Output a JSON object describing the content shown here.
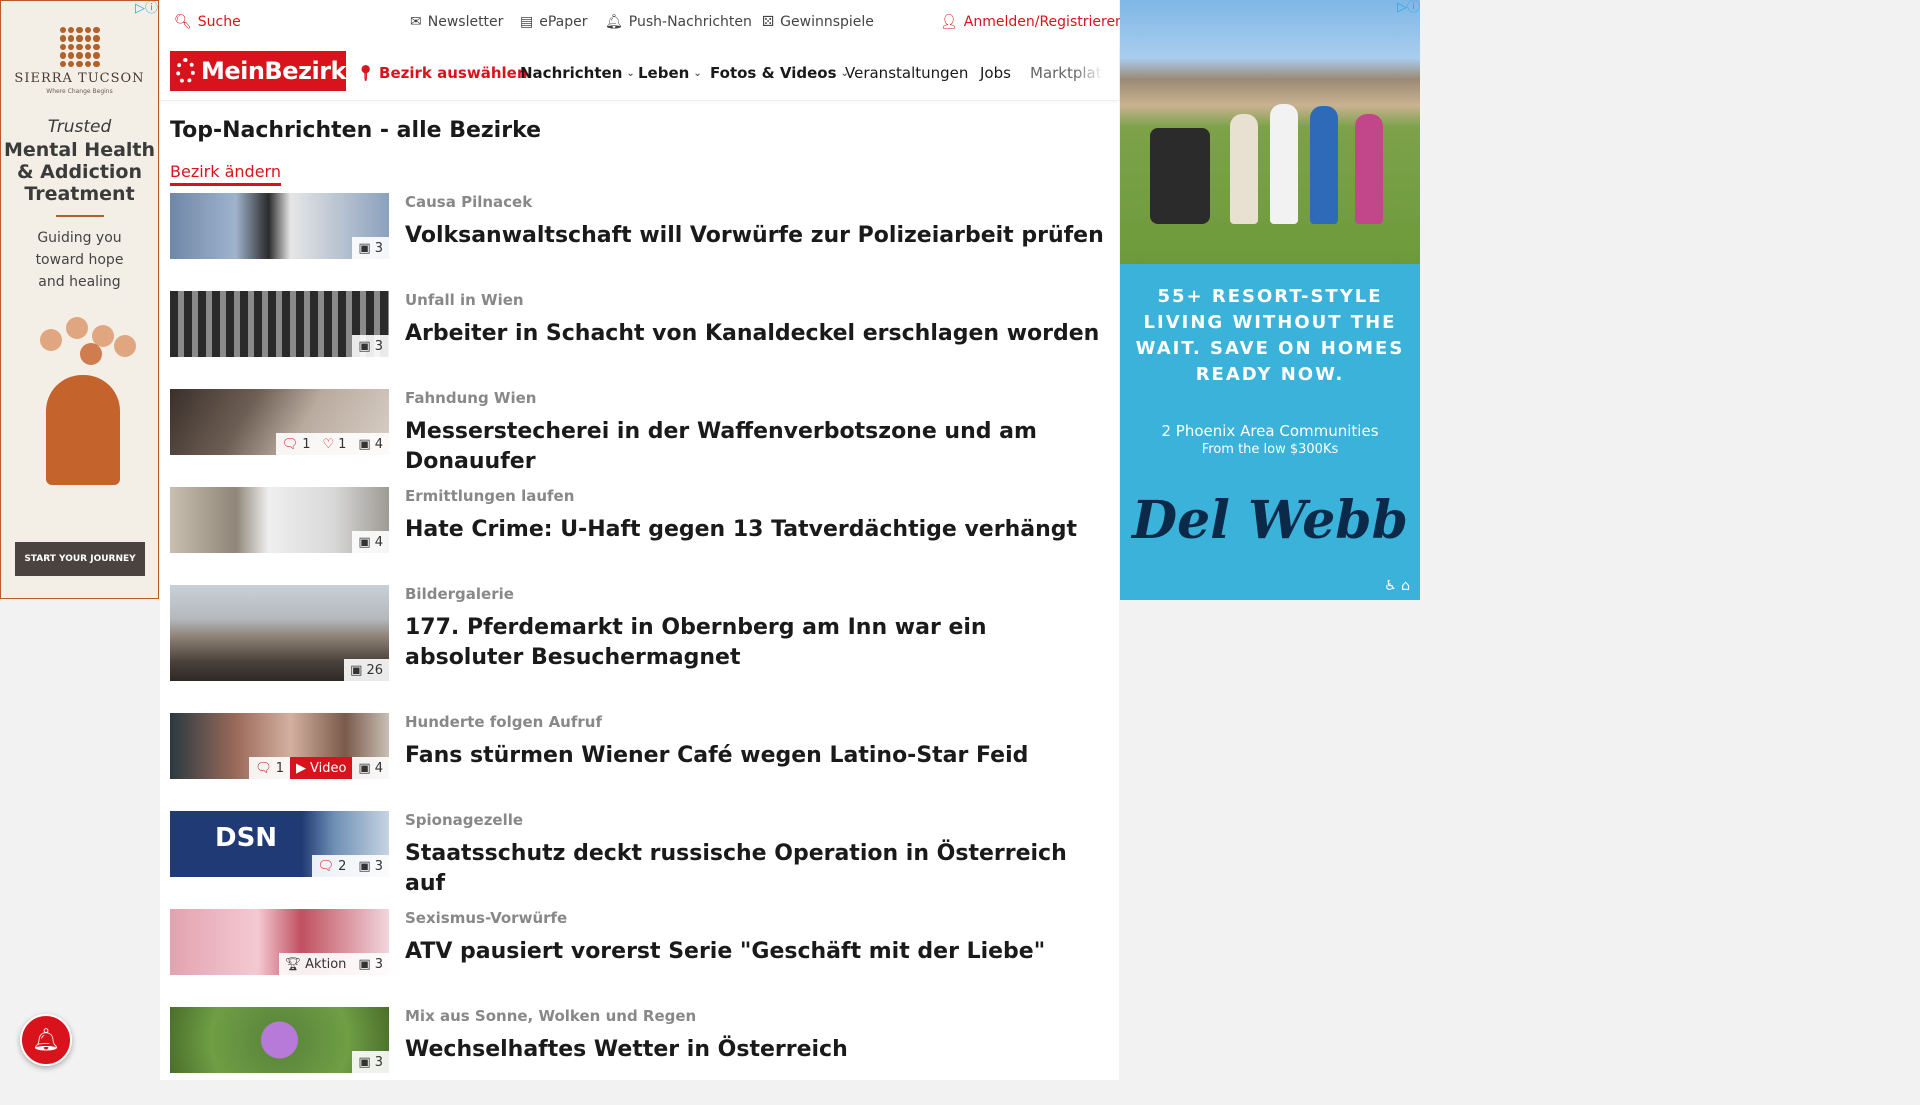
{
  "ad_left": {
    "brand": "SIERRA TUCSON",
    "brand_tag": "Where Change Begins",
    "trusted": "Trusted",
    "headline": "Mental Health & Addiction Treatment",
    "subline": "Guiding you toward hope and healing",
    "cta": "START YOUR JOURNEY",
    "colors": {
      "accent": "#b0612d",
      "bg": "#f3efe7"
    }
  },
  "topbar": {
    "search": "Suche",
    "newsletter": "Newsletter",
    "epaper": "ePaper",
    "push": "Push-Nachrichten",
    "games": "Gewinnspiele",
    "login": "Anmelden/Registrieren"
  },
  "nav": {
    "logo": "MeinBezirk",
    "choose_district": "Bezirk auswählen",
    "items": [
      "Nachrichten",
      "Leben",
      "Fotos & Videos",
      "Veranstaltungen",
      "Jobs",
      "Marktplatz"
    ]
  },
  "section": {
    "title": "Top-Nachrichten - alle Bezirke",
    "change": "Bezirk ändern"
  },
  "articles": [
    {
      "kicker": "Causa Pilnacek",
      "title": "Volksanwaltschaft will Vorwürfe zur Polizeiarbeit prüfen",
      "comments": "",
      "likes": "",
      "photos": "3"
    },
    {
      "kicker": "Unfall in Wien",
      "title": "Arbeiter in Schacht von Kanaldeckel erschlagen worden",
      "comments": "",
      "likes": "",
      "photos": "3"
    },
    {
      "kicker": "Fahndung Wien",
      "title": "Messerstecherei in der Waffenverbotszone und am Donauufer",
      "comments": "1",
      "likes": "1",
      "photos": "4"
    },
    {
      "kicker": "Ermittlungen laufen",
      "title": "Hate Crime: U-Haft gegen 13 Tatverdächtige verhängt",
      "comments": "",
      "likes": "",
      "photos": "4"
    },
    {
      "kicker": "Bildergalerie",
      "title": "177. Pferdemarkt in Obernberg am Inn war ein absoluter Besuchermagnet",
      "comments": "",
      "likes": "",
      "photos": "26"
    },
    {
      "kicker": "Hunderte folgen Aufruf",
      "title": "Fans stürmen Wiener Café wegen Latino-Star Feid",
      "comments": "1",
      "video": "Video",
      "photos": "4"
    },
    {
      "kicker": "Spionagezelle",
      "title": "Staatsschutz deckt russische Operation in Österreich auf",
      "comments": "2",
      "photos": "3",
      "thumb_text": "DSN"
    },
    {
      "kicker": "Sexismus-Vorwürfe",
      "title": "ATV pausiert vorerst Serie \"Geschäft mit der Liebe\"",
      "aktion": "Aktion",
      "photos": "3"
    },
    {
      "kicker": "Mix aus Sonne, Wolken und Regen",
      "title": "Wechselhaftes Wetter in Österreich",
      "photos": "3"
    }
  ],
  "ad_right": {
    "headline": "55+ RESORT-STYLE LIVING WITHOUT THE WAIT. SAVE ON HOMES READY NOW.",
    "sub": "2 Phoenix Area Communities",
    "sub2": "From the low $300Ks",
    "logo": "Del Webb",
    "colors": {
      "bg": "#3ab2d9",
      "logo": "#0b2a4a"
    }
  },
  "colors": {
    "brand_red": "#d8131b"
  }
}
